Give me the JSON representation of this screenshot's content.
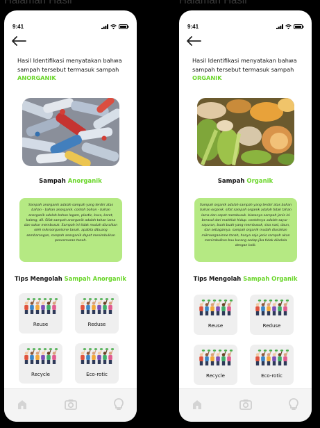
{
  "frames": [
    {
      "frame_title": "Halaman Hasil",
      "time": "9:41",
      "headline": "Hasil Identifikasi menyatakan bahwa sampah tersebut termasuk sampah",
      "headline_accent": "ANORGANIK",
      "type_label": "Sampah",
      "type_accent": "Anorganik",
      "description": "Sampah anorganik adalah sampah yang terdiri atas bahan - bahan anorganik. contoh bahan - bahan anorganik adalah bahan logam, plastic, kaca, karet, kaleng, dll. Sifat sampah anorganik adalah tahan lama dan sukar membusuk. Sampah ini tidak mudah diuraikan oleh mikroorganisme tanah. apabila dibuang sembarangan, sampah anorganik dapat menimbulkan pencemaran tanah.",
      "tips_label": "Tips Mengolah",
      "tips_accent": "Sampah Anorganik",
      "tips": [
        "Reuse",
        "Reduse",
        "Recycle",
        "Eco-rotic"
      ]
    },
    {
      "frame_title": "Halaman Hasil",
      "time": "9:41",
      "headline": "Hasil Identifikasi menyatakan bahwa sampah tersebut termasuk sampah",
      "headline_accent": "ORGANIK",
      "type_label": "Sampah",
      "type_accent": "Organik",
      "description": "Sampah organik adalah sampah yang terdiri atas bahan bahan organik. sifat sampah organik adalah tidak tahan lama dan cepat membusuk. biasanya sampah jenis ini berasal dari makhluk hidup. contohnya adalah sayur - sayuran, buah buah yang membusuk, sisa nasi, daun, dan sebagainya. sampah organik mudah diuraikan mikroorganisme tanah, hanya saja jenis sampah akan menimbulkan bau kurang sedap jika tidak dikelola dengan baik.",
      "tips_label": "Tips Mengolah",
      "tips_accent": "Sampah Organik",
      "tips": [
        "Reuse",
        "Reduse",
        "Recycle",
        "Eco-rotic"
      ]
    }
  ],
  "colors": {
    "accent": "#6ad62a",
    "desc_box": "#b5e983",
    "card": "#efefef",
    "nav_bg": "#f4f4f4"
  },
  "icons": {
    "back": "arrow-left-icon",
    "nav": [
      "home-icon",
      "camera-icon",
      "lightbulb-icon"
    ]
  }
}
